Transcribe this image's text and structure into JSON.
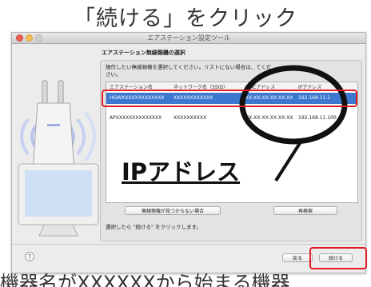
{
  "heading": "「続ける」をクリック",
  "window": {
    "title": "エアステーション設定ツール",
    "section_title": "エアステーション無線親機の選択",
    "instruction": "操作したい無線親機を選択してください。リストにない場合は、",
    "instruction_tail": "てくだ",
    "instruction_line2": "さい。",
    "columns": [
      "エアステーション名",
      "ネットワーク名（SSID）",
      "MACアドレス",
      "IPアドレス"
    ],
    "rows": [
      {
        "name": "HGWXXXXXXXXXXXXX",
        "ssid": "XXXXXXXXXXXX",
        "mac": "XX:XX:XX:XX:XX:XX",
        "ip": "192.168.11.1"
      },
      {
        "name": "APXXXXXXXXXXXXXX",
        "ssid": "XXXXXXXXXX",
        "mac": "XX:XX:XX:XX:XX:XX",
        "ip": "192.168.11.100"
      }
    ],
    "not_found_button": "無線親機が見つからない場合",
    "rescan_button": "再検索",
    "bottom_text": "選択したら \"続ける\" をクリックします。",
    "help_label": "?",
    "back_button": "戻る",
    "continue_button": "続ける"
  },
  "annotation": {
    "ip_label": "IPアドレス"
  },
  "bottom_caption": "機器名がXXXXXXから始まる機器",
  "colors": {
    "highlight": "#e41b23",
    "selection": "#3c78d0"
  }
}
